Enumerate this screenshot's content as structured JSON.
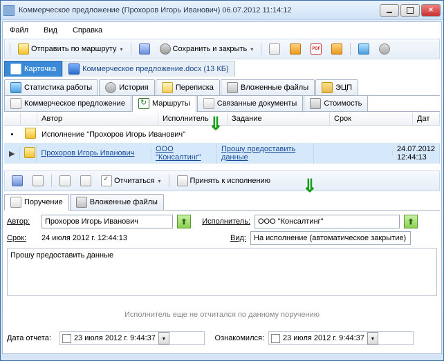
{
  "window": {
    "title": "Коммерческое предложение (Прохоров Игорь Иванович) 06.07.2012 11:14:12"
  },
  "menu": {
    "file": "Файл",
    "view": "Вид",
    "help": "Справка"
  },
  "toolbar": {
    "send_route": "Отправить по маршруту",
    "save_close": "Сохранить и закрыть"
  },
  "filetabs": {
    "card": "Карточка",
    "attachment": "Коммерческое предложение.docx (13 КБ)"
  },
  "tabs_top": {
    "stats": "Статистика работы",
    "history": "История",
    "correspondence": "Переписка",
    "attachments": "Вложенные файлы",
    "signature": "ЭЦП"
  },
  "tabs_mid": {
    "offer": "Коммерческое предложение",
    "routes": "Маршруты",
    "linked": "Связанные документы",
    "cost": "Стоимость"
  },
  "list": {
    "hdr": {
      "author": "Автор",
      "executor": "Исполнитель",
      "task": "Задание",
      "deadline": "Срок",
      "date": "Дат"
    },
    "group": "Исполнение \"Прохоров Игорь Иванович\"",
    "row": {
      "author": "Прохоров Игорь Иванович",
      "executor": "ООО \"Консалтинг\"",
      "task": "Прошу предоставить данные",
      "date": "24.07.2012 12:44:13"
    }
  },
  "toolbar2": {
    "report": "Отчитаться",
    "accept": "Принять к исполнению"
  },
  "tabs_bot": {
    "assignment": "Поручение",
    "attachments": "Вложенные файлы"
  },
  "form": {
    "author_lbl": "Автор:",
    "author_val": "Прохоров Игорь Иванович",
    "executor_lbl": "Исполнитель:",
    "executor_val": "ООО \"Консалтинг\"",
    "deadline_lbl": "Срок:",
    "deadline_val": "24    июля    2012 г. 12:44:13",
    "kind_lbl": "Вид:",
    "kind_val": "На исполнение (автоматическое закрытие)",
    "body": "Прошу предоставить данные",
    "status": "Исполнитель еще не отчитался по данному поручению",
    "report_date_lbl": "Дата отчета:",
    "ack_lbl": "Ознакомился:",
    "date_val": "23    июля    2012 г.  9:44:37"
  }
}
